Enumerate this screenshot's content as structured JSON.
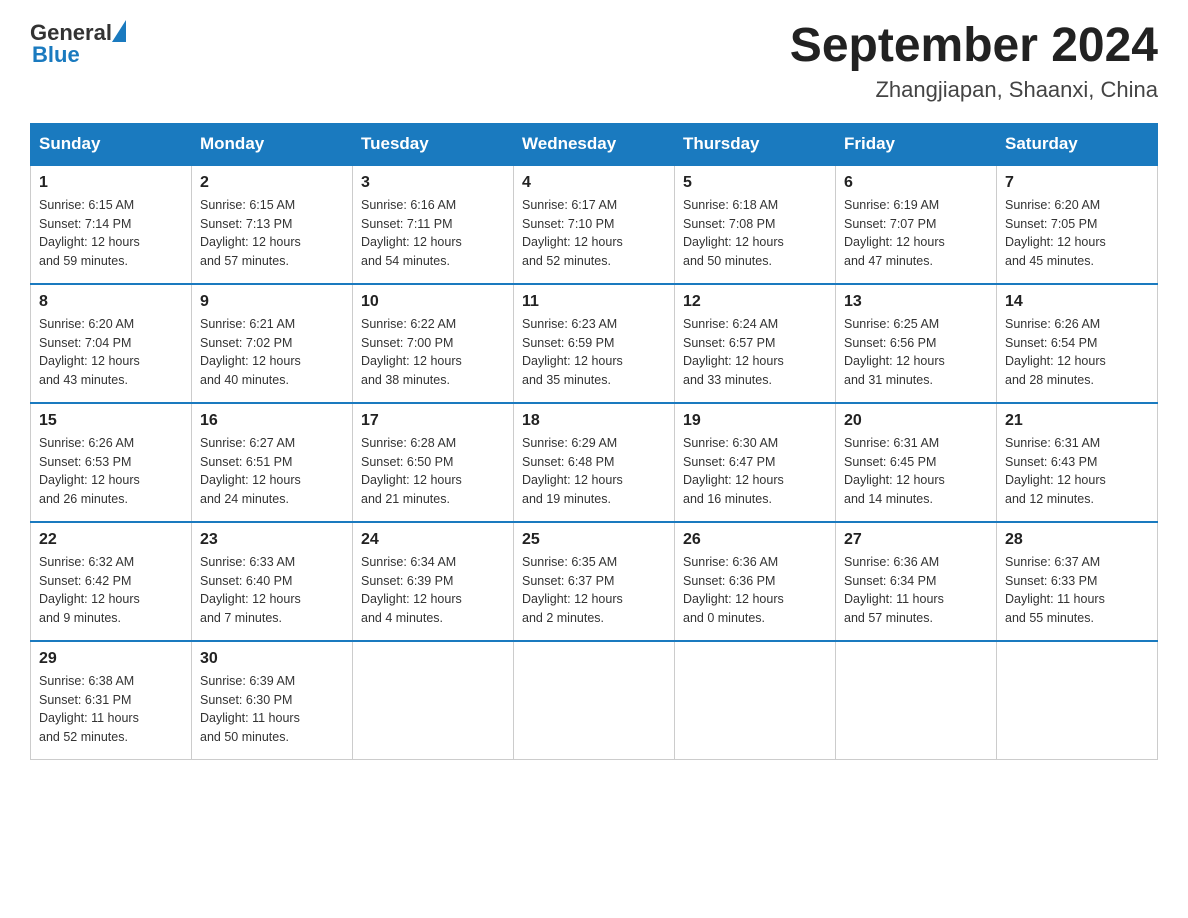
{
  "header": {
    "logo_general": "General",
    "logo_blue": "Blue",
    "title": "September 2024",
    "subtitle": "Zhangjiapan, Shaanxi, China"
  },
  "days_of_week": [
    "Sunday",
    "Monday",
    "Tuesday",
    "Wednesday",
    "Thursday",
    "Friday",
    "Saturday"
  ],
  "weeks": [
    [
      {
        "day": "1",
        "sunrise": "6:15 AM",
        "sunset": "7:14 PM",
        "daylight": "12 hours and 59 minutes."
      },
      {
        "day": "2",
        "sunrise": "6:15 AM",
        "sunset": "7:13 PM",
        "daylight": "12 hours and 57 minutes."
      },
      {
        "day": "3",
        "sunrise": "6:16 AM",
        "sunset": "7:11 PM",
        "daylight": "12 hours and 54 minutes."
      },
      {
        "day": "4",
        "sunrise": "6:17 AM",
        "sunset": "7:10 PM",
        "daylight": "12 hours and 52 minutes."
      },
      {
        "day": "5",
        "sunrise": "6:18 AM",
        "sunset": "7:08 PM",
        "daylight": "12 hours and 50 minutes."
      },
      {
        "day": "6",
        "sunrise": "6:19 AM",
        "sunset": "7:07 PM",
        "daylight": "12 hours and 47 minutes."
      },
      {
        "day": "7",
        "sunrise": "6:20 AM",
        "sunset": "7:05 PM",
        "daylight": "12 hours and 45 minutes."
      }
    ],
    [
      {
        "day": "8",
        "sunrise": "6:20 AM",
        "sunset": "7:04 PM",
        "daylight": "12 hours and 43 minutes."
      },
      {
        "day": "9",
        "sunrise": "6:21 AM",
        "sunset": "7:02 PM",
        "daylight": "12 hours and 40 minutes."
      },
      {
        "day": "10",
        "sunrise": "6:22 AM",
        "sunset": "7:00 PM",
        "daylight": "12 hours and 38 minutes."
      },
      {
        "day": "11",
        "sunrise": "6:23 AM",
        "sunset": "6:59 PM",
        "daylight": "12 hours and 35 minutes."
      },
      {
        "day": "12",
        "sunrise": "6:24 AM",
        "sunset": "6:57 PM",
        "daylight": "12 hours and 33 minutes."
      },
      {
        "day": "13",
        "sunrise": "6:25 AM",
        "sunset": "6:56 PM",
        "daylight": "12 hours and 31 minutes."
      },
      {
        "day": "14",
        "sunrise": "6:26 AM",
        "sunset": "6:54 PM",
        "daylight": "12 hours and 28 minutes."
      }
    ],
    [
      {
        "day": "15",
        "sunrise": "6:26 AM",
        "sunset": "6:53 PM",
        "daylight": "12 hours and 26 minutes."
      },
      {
        "day": "16",
        "sunrise": "6:27 AM",
        "sunset": "6:51 PM",
        "daylight": "12 hours and 24 minutes."
      },
      {
        "day": "17",
        "sunrise": "6:28 AM",
        "sunset": "6:50 PM",
        "daylight": "12 hours and 21 minutes."
      },
      {
        "day": "18",
        "sunrise": "6:29 AM",
        "sunset": "6:48 PM",
        "daylight": "12 hours and 19 minutes."
      },
      {
        "day": "19",
        "sunrise": "6:30 AM",
        "sunset": "6:47 PM",
        "daylight": "12 hours and 16 minutes."
      },
      {
        "day": "20",
        "sunrise": "6:31 AM",
        "sunset": "6:45 PM",
        "daylight": "12 hours and 14 minutes."
      },
      {
        "day": "21",
        "sunrise": "6:31 AM",
        "sunset": "6:43 PM",
        "daylight": "12 hours and 12 minutes."
      }
    ],
    [
      {
        "day": "22",
        "sunrise": "6:32 AM",
        "sunset": "6:42 PM",
        "daylight": "12 hours and 9 minutes."
      },
      {
        "day": "23",
        "sunrise": "6:33 AM",
        "sunset": "6:40 PM",
        "daylight": "12 hours and 7 minutes."
      },
      {
        "day": "24",
        "sunrise": "6:34 AM",
        "sunset": "6:39 PM",
        "daylight": "12 hours and 4 minutes."
      },
      {
        "day": "25",
        "sunrise": "6:35 AM",
        "sunset": "6:37 PM",
        "daylight": "12 hours and 2 minutes."
      },
      {
        "day": "26",
        "sunrise": "6:36 AM",
        "sunset": "6:36 PM",
        "daylight": "12 hours and 0 minutes."
      },
      {
        "day": "27",
        "sunrise": "6:36 AM",
        "sunset": "6:34 PM",
        "daylight": "11 hours and 57 minutes."
      },
      {
        "day": "28",
        "sunrise": "6:37 AM",
        "sunset": "6:33 PM",
        "daylight": "11 hours and 55 minutes."
      }
    ],
    [
      {
        "day": "29",
        "sunrise": "6:38 AM",
        "sunset": "6:31 PM",
        "daylight": "11 hours and 52 minutes."
      },
      {
        "day": "30",
        "sunrise": "6:39 AM",
        "sunset": "6:30 PM",
        "daylight": "11 hours and 50 minutes."
      },
      null,
      null,
      null,
      null,
      null
    ]
  ],
  "labels": {
    "sunrise": "Sunrise:",
    "sunset": "Sunset:",
    "daylight": "Daylight:"
  }
}
